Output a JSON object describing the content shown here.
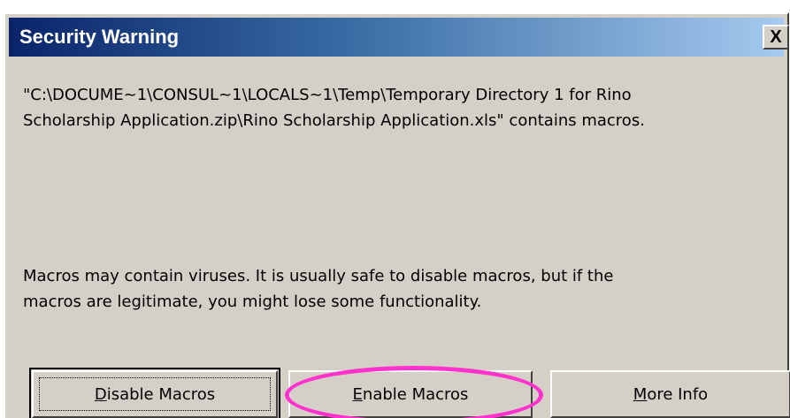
{
  "dialog": {
    "title": "Security Warning",
    "close_label": "X"
  },
  "message": {
    "line1": "\"C:\\DOCUME~1\\CONSUL~1\\LOCALS~1\\Temp\\Temporary Directory 1 for Rino",
    "line2": "Scholarship Application.zip\\Rino Scholarship Application.xls\" contains macros."
  },
  "warning": {
    "line1": "Macros may contain viruses. It is usually safe to disable macros, but if the",
    "line2": "macros are legitimate, you might lose some functionality."
  },
  "buttons": {
    "disable": {
      "mnemonic": "D",
      "rest": "isable Macros"
    },
    "enable": {
      "mnemonic": "E",
      "rest": "nable Macros"
    },
    "more_info": {
      "mnemonic": "M",
      "rest": "ore Info"
    }
  },
  "colors": {
    "titlebar_start": "#0a246a",
    "titlebar_end": "#a6caf0",
    "dialog_face": "#d4d0c8",
    "highlight": "#ff33cc"
  }
}
